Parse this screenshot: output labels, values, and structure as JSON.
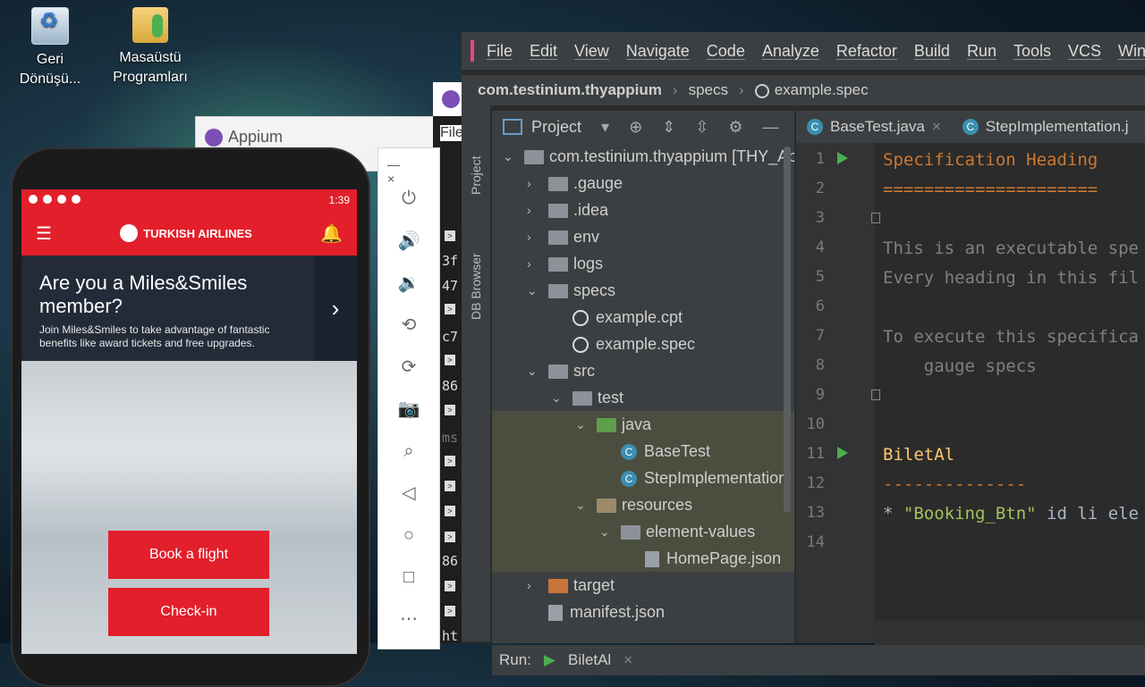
{
  "desktop": {
    "icons": [
      {
        "name": "Geri Dönüşü...",
        "icon": "recycle-bin-icon"
      },
      {
        "name": "Masaüstü Programları",
        "icon": "folder-icon"
      }
    ]
  },
  "appium_window": {
    "title": "Appium"
  },
  "terminal": {
    "file_menu": "File",
    "lines": [
      "3f",
      "47",
      "c7",
      "86",
      "ms",
      "86",
      "ht"
    ]
  },
  "phone": {
    "status_time": "1:39",
    "airline": "TURKISH AIRLINES",
    "banner_title": "Are you a Miles&Smiles member?",
    "banner_text": "Join Miles&Smiles to take advantage of fantastic benefits like award tickets and free upgrades.",
    "buttons": [
      "Book a flight",
      "Check-in"
    ]
  },
  "emulator_toolbar": {
    "minimize": "—",
    "close": "×",
    "buttons": [
      "power",
      "volume-up",
      "volume-down",
      "rotate-left",
      "rotate-right",
      "screenshot",
      "zoom",
      "back",
      "home",
      "overview",
      "more"
    ]
  },
  "ide": {
    "menu": [
      "File",
      "Edit",
      "View",
      "Navigate",
      "Code",
      "Analyze",
      "Refactor",
      "Build",
      "Run",
      "Tools",
      "VCS",
      "Win"
    ],
    "breadcrumb": {
      "project": "com.testinium.thyappium",
      "folder": "specs",
      "file": "example.spec"
    },
    "side_tabs": {
      "project": "Project",
      "db": "DB Browser"
    },
    "project_panel": {
      "header": "Project",
      "tree": [
        {
          "label": "com.testinium.thyappium [THY_Ap",
          "level": 0,
          "arrow": "open",
          "type": "module"
        },
        {
          "label": ".gauge",
          "level": 1,
          "arrow": "closed",
          "type": "folder"
        },
        {
          "label": ".idea",
          "level": 1,
          "arrow": "closed",
          "type": "folder"
        },
        {
          "label": "env",
          "level": 1,
          "arrow": "closed",
          "type": "folder"
        },
        {
          "label": "logs",
          "level": 1,
          "arrow": "closed",
          "type": "folder"
        },
        {
          "label": "specs",
          "level": 1,
          "arrow": "open",
          "type": "folder"
        },
        {
          "label": "example.cpt",
          "level": 2,
          "arrow": "none",
          "type": "gauge"
        },
        {
          "label": "example.spec",
          "level": 2,
          "arrow": "none",
          "type": "gauge"
        },
        {
          "label": "src",
          "level": 1,
          "arrow": "open",
          "type": "folder"
        },
        {
          "label": "test",
          "level": 2,
          "arrow": "open",
          "type": "folder"
        },
        {
          "label": "java",
          "level": 3,
          "arrow": "open",
          "type": "folder-green"
        },
        {
          "label": "BaseTest",
          "level": 4,
          "arrow": "none",
          "type": "class"
        },
        {
          "label": "StepImplementation",
          "level": 4,
          "arrow": "none",
          "type": "class"
        },
        {
          "label": "resources",
          "level": 3,
          "arrow": "open",
          "type": "folder-res"
        },
        {
          "label": "element-values",
          "level": 4,
          "arrow": "open",
          "type": "folder"
        },
        {
          "label": "HomePage.json",
          "level": 5,
          "arrow": "none",
          "type": "json"
        },
        {
          "label": "target",
          "level": 1,
          "arrow": "closed",
          "type": "folder-orange"
        },
        {
          "label": "manifest.json",
          "level": 1,
          "arrow": "none",
          "type": "json"
        }
      ]
    },
    "tabs": [
      {
        "label": "BaseTest.java",
        "close": "×"
      },
      {
        "label": "StepImplementation.j",
        "close": ""
      }
    ],
    "code_lines": [
      {
        "n": "1",
        "text": "Specification Heading",
        "style": "orange"
      },
      {
        "n": "2",
        "text": "=====================",
        "style": "orange"
      },
      {
        "n": "3",
        "text": "",
        "style": "norm"
      },
      {
        "n": "4",
        "text": "This is an executable spe",
        "style": "gray"
      },
      {
        "n": "5",
        "text": "Every heading in this fil",
        "style": "gray"
      },
      {
        "n": "6",
        "text": "",
        "style": "norm"
      },
      {
        "n": "7",
        "text": "To execute this specifica",
        "style": "gray"
      },
      {
        "n": "8",
        "text": "    gauge specs",
        "style": "gray"
      },
      {
        "n": "9",
        "text": "",
        "style": "norm"
      },
      {
        "n": "10",
        "text": "",
        "style": "norm"
      },
      {
        "n": "11",
        "text": "BiletAl",
        "style": "yellow"
      },
      {
        "n": "12",
        "text": "--------------",
        "style": "orange"
      },
      {
        "n": "13",
        "text": "* ",
        "style": "norm"
      },
      {
        "n": "14",
        "text": "",
        "style": "norm"
      }
    ],
    "line13": {
      "bullet": "* ",
      "string": "\"Booking_Btn\"",
      "rest": " id li ele"
    },
    "run_bar": {
      "label": "Run:",
      "config": "BiletAl",
      "close": "×"
    }
  }
}
